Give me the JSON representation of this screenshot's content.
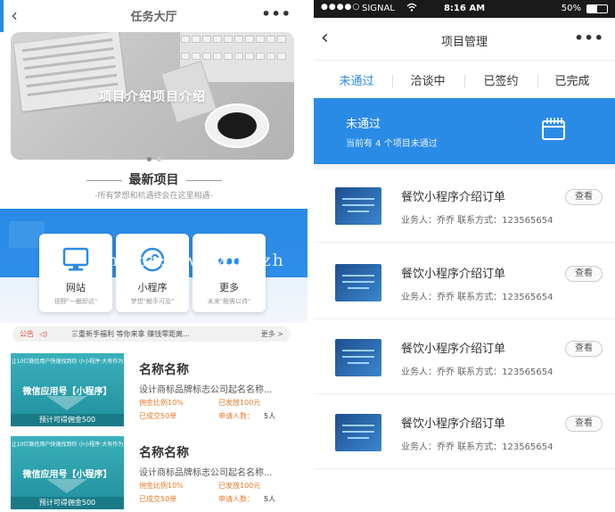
{
  "left": {
    "header": {
      "title": "任务大厅",
      "back_icon": "chevron-left-icon",
      "more_icon": "more-icon"
    },
    "banner": {
      "text": "项目介绍项目介绍",
      "active_dot": 0,
      "dots": 2
    },
    "section": {
      "title": "最新项目",
      "subtitle": "-所有梦想和机遇终会在这里相遇-"
    },
    "categories": [
      {
        "name": "网站",
        "desc": "视野\"一触即达\"",
        "icon": "monitor-icon"
      },
      {
        "name": "小程序",
        "desc": "梦想\"触手可及\"",
        "icon": "mini-program-icon"
      },
      {
        "name": "更多",
        "desc": "未来\"触需以待\"",
        "icon": "more-dots-icon"
      }
    ],
    "watermark": "https://www.huzh",
    "notice": {
      "tag": "公告",
      "text": "三重新手福利 等你来拿 赚钱零距离...",
      "more": "更多 >"
    },
    "projects": [
      {
        "thumb_top": "让10亿微信用户快速找到你 小小程序·大有作为",
        "thumb_title": "微信应用号【小程序】",
        "thumb_bottom": "预计可得佣金500",
        "name": "名称名称",
        "desc": "设计商标品牌标志公司起名名称...",
        "ratio": "佣金比例10%",
        "sent": "已发放100元",
        "deals": "已成交50单",
        "apply_label": "申请人数：",
        "apply_count": "5人"
      },
      {
        "thumb_top": "让10亿微信用户快速找到你 小小程序·大有作为",
        "thumb_title": "微信应用号【小程序】",
        "thumb_bottom": "预计可得佣金500",
        "name": "名称名称",
        "desc": "设计商标品牌标志公司起名名称...",
        "ratio": "佣金比例10%",
        "sent": "已发放100元",
        "deals": "已成交50单",
        "apply_label": "申请人数：",
        "apply_count": "5人"
      }
    ]
  },
  "right": {
    "status_bar": {
      "signal": "●●●●○",
      "carrier": "SIGNAL",
      "time": "8:16 AM",
      "battery": "50%",
      "battery_level": 0.5
    },
    "header": {
      "title": "项目管理",
      "back_icon": "chevron-left-icon",
      "more_icon": "more-icon"
    },
    "tabs": [
      "未通过",
      "洽谈中",
      "已签约",
      "已完成"
    ],
    "active_tab": 0,
    "status_panel": {
      "title": "未通过",
      "subtitle": "当前有 4 个项目未通过",
      "icon": "notebook-icon"
    },
    "orders": [
      {
        "title": "餐饮小程序介绍订单",
        "meta": "业务人：乔乔  联系方式：123565654",
        "button": "查看"
      },
      {
        "title": "餐饮小程序介绍订单",
        "meta": "业务人：乔乔  联系方式：123565654",
        "button": "查看"
      },
      {
        "title": "餐饮小程序介绍订单",
        "meta": "业务人：乔乔  联系方式：123565654",
        "button": "查看"
      },
      {
        "title": "餐饮小程序介绍订单",
        "meta": "业务人：乔乔  联系方式：123565654",
        "button": "查看"
      }
    ]
  },
  "colors": {
    "accent": "#2a8be6",
    "orange": "#e67b2b",
    "notice_red": "#e34b3b",
    "teal": "#2aa3b0"
  }
}
